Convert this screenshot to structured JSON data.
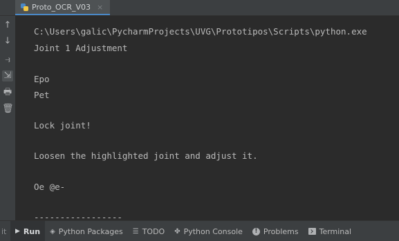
{
  "tab": {
    "title": "Proto_OCR_V03",
    "close_glyph": "×"
  },
  "gutter": {
    "buttons": [
      {
        "name": "rerun-up-icon",
        "glyph": "↑"
      },
      {
        "name": "scroll-down-icon",
        "glyph": "↓"
      },
      {
        "name": "soft-wrap-icon",
        "glyph": "⥽"
      },
      {
        "name": "scroll-to-end-icon",
        "glyph": "⇲"
      },
      {
        "name": "print-icon",
        "glyph": "🖶"
      },
      {
        "name": "trash-icon",
        "glyph": "🗑"
      }
    ]
  },
  "console": {
    "lines": [
      "C:\\Users\\galic\\PycharmProjects\\UVG\\Prototipos\\Scripts\\python.exe",
      "Joint 1 Adjustment",
      "",
      "Epo",
      "Pet",
      "",
      "Lock joint!",
      "",
      "Loosen the highlighted joint and adjust it.",
      "",
      "Oe @e-",
      "",
      "-----------------"
    ]
  },
  "statusbar": {
    "cut_label": "it",
    "run": "Run",
    "packages": "Python Packages",
    "todo": "TODO",
    "python_console": "Python Console",
    "problems": "Problems",
    "terminal": "Terminal"
  },
  "colors": {
    "background": "#2b2b2b",
    "panel": "#3c3f41",
    "text": "#bbbbbb",
    "accent": "#4a88c7"
  }
}
